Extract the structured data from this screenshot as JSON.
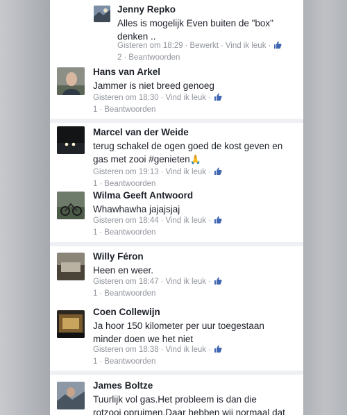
{
  "comments": [
    {
      "name": "Jenny Repko",
      "text": "Alles is mogelijk  Even buiten de \"box\"\ndenken ..",
      "time": "Gisteren om 18:29",
      "edited": "Bewerkt",
      "like_label": "Vind ik leuk",
      "likes": "2",
      "reply_label": "Beantwoorden"
    },
    {
      "name": "Hans van Arkel",
      "text": "Jammer is niet breed genoeg",
      "time": "Gisteren om 18:30",
      "like_label": "Vind ik leuk",
      "likes": "1",
      "reply_label": "Beantwoorden"
    },
    {
      "name": "Marcel van der Weide",
      "text": "terug schakel de ogen goed de kost geven en\ngas met zooi #genieten",
      "emoji": "🙏",
      "time": "Gisteren om 19:13",
      "like_label": "Vind ik leuk",
      "likes": "1",
      "reply_label": "Beantwoorden"
    },
    {
      "name": "Wilma Geeft Antwoord",
      "text": "Whawhawha   jajajsjaj",
      "time": "Gisteren om 18:44",
      "like_label": "Vind ik leuk",
      "likes": "1",
      "reply_label": "Beantwoorden"
    },
    {
      "name": "Willy Féron",
      "text": "Heen en weer.",
      "time": "Gisteren om 18:47",
      "like_label": "Vind ik leuk",
      "likes": "1",
      "reply_label": "Beantwoorden"
    },
    {
      "name": "Coen Collewijn",
      "text": "Ja hoor 150 kilometer per uur toegestaan\nminder doen we het niet",
      "time": "Gisteren om 18:38",
      "like_label": "Vind ik leuk",
      "likes": "1",
      "reply_label": "Beantwoorden"
    },
    {
      "name": "James Boltze",
      "text": "Tuurlijk vol gas.Het probleem is dan die\nrotzooi opruimen.Daar hebben wij normaal dat"
    }
  ],
  "colors": {
    "like_icon": "#4267b2",
    "meta_text": "#90949c",
    "name_text": "#1d2129"
  }
}
